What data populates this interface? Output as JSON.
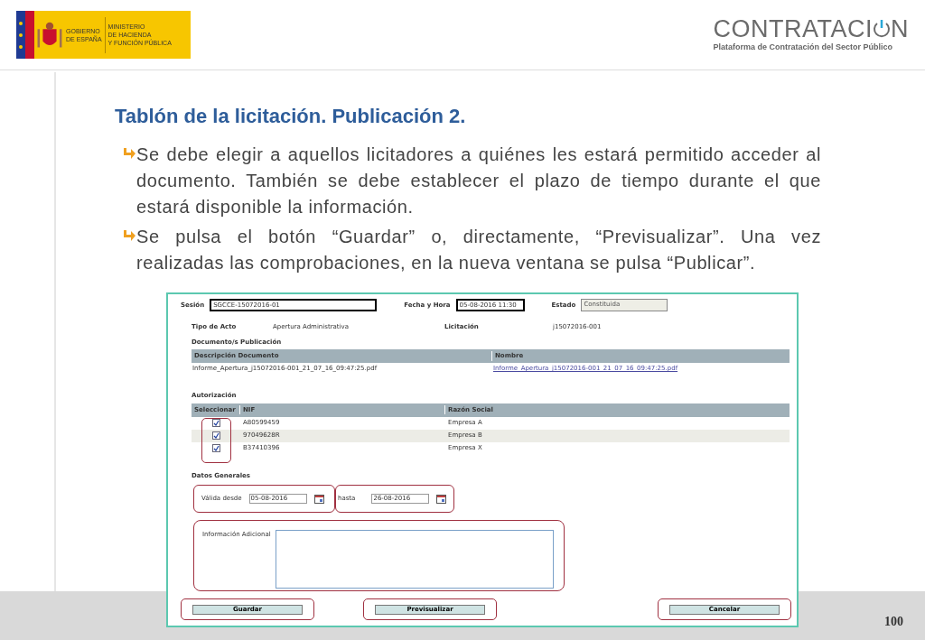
{
  "header": {
    "gov_logo": {
      "line_1": "GOBIERNO",
      "line_2": "DE ESPAÑA",
      "ministry_1": "MINISTERIO",
      "ministry_2": "DE HACIENDA",
      "ministry_3": "Y FUNCIÓN PÚBLICA"
    },
    "brand": {
      "name": "CONTRATACI",
      "name_end": "N",
      "subtitle": "Plataforma de Contratación del Sector Público"
    }
  },
  "title": "Tablón de la licitación. Publicación 2.",
  "bullets": [
    "Se debe elegir a aquellos licitadores a quiénes les estará permitido acceder al documento. También se debe establecer el plazo de tiempo durante el que estará disponible la información.",
    "Se pulsa el botón “Guardar” o, directamente, “Previsualizar”. Una vez realizadas las comprobaciones, en la nueva ventana se pulsa “Publicar”."
  ],
  "form": {
    "top_fields": [
      {
        "label": "Sesión",
        "value": "SGCCE-15072016-01",
        "kind": "input"
      },
      {
        "label": "Fecha y Hora",
        "value": "05-08-2016 11:30",
        "kind": "input"
      },
      {
        "label": "Estado",
        "value": "Constituida",
        "kind": "readonly"
      }
    ],
    "info": [
      {
        "label": "Tipo de Acto",
        "value": "Apertura Administrativa"
      },
      {
        "label": "Licitación",
        "value": "j15072016-001"
      }
    ],
    "documents": {
      "heading": "Documento/s Publicación",
      "columns": [
        "Descripción Documento",
        "Nombre"
      ],
      "rows": [
        {
          "description": "Informe_Apertura_j15072016-001_21_07_16_09:47:25.pdf",
          "name": "Informe_Apertura_j15072016-001_21_07_16_09:47:25.pdf"
        }
      ]
    },
    "authorization": {
      "heading": "Autorización",
      "columns": [
        "Seleccionar",
        "NIF",
        "Razón Social"
      ],
      "rows": [
        {
          "checked": true,
          "nif": "A80599459",
          "company": "Empresa A"
        },
        {
          "checked": true,
          "nif": "97049628R",
          "company": "Empresa B"
        },
        {
          "checked": true,
          "nif": "B37410396",
          "company": "Empresa X"
        }
      ]
    },
    "general": {
      "heading": "Datos Generales",
      "from_label": "Válida desde",
      "from_value": "05-08-2016",
      "to_label": "hasta",
      "to_value": "26-08-2016",
      "info_label": "Información Adicional"
    },
    "buttons": [
      "Guardar",
      "Previsualizar",
      "Cancelar"
    ]
  },
  "page_number": "100"
}
